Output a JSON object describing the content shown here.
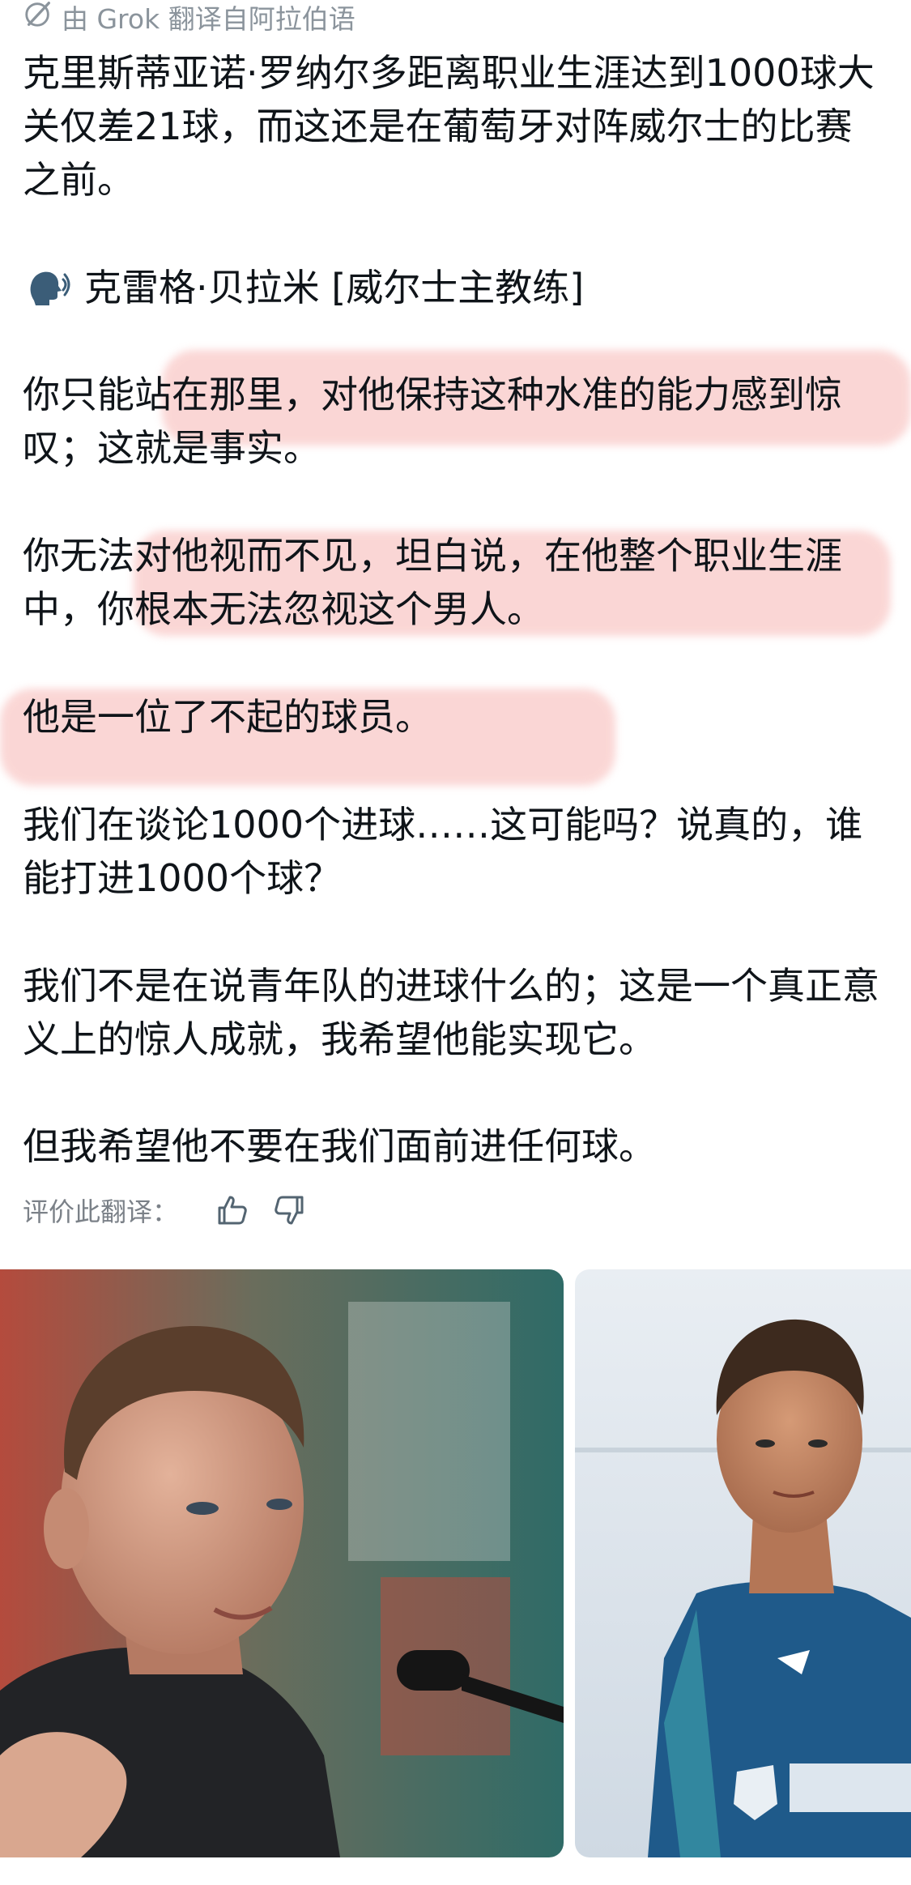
{
  "header": {
    "translated_by": "由 Grok 翻译自阿拉伯语",
    "icon": "translate-icon"
  },
  "post": {
    "intro": "克里斯蒂亚诺·罗纳尔多距离职业生涯达到1000球大关仅差21球，而这还是在葡萄牙对阵威尔士的比赛之前。",
    "speaker_emoji": "speaking-head-icon",
    "speaker": "克雷格·贝拉米 [威尔士主教练]",
    "quote_1": "你只能站在那里，对他保持这种水准的能力感到惊叹；这就是事实。",
    "quote_2": "你无法对他视而不见，坦白说，在他整个职业生涯中，你根本无法忽视这个男人。",
    "quote_3": "他是一位了不起的球员。",
    "quote_4": "我们在谈论1000个进球……这可能吗？说真的，谁能打进1000个球？",
    "quote_5": "我们不是在说青年队的进球什么的；这是一个真正意义上的惊人成就，我希望他能实现它。",
    "quote_6": "但我希望他不要在我们面前进任何球。"
  },
  "rating": {
    "label": "评价此翻译：",
    "thumbs_up_icon": "thumbs-up-icon",
    "thumbs_down_icon": "thumbs-down-icon"
  },
  "colors": {
    "text": "#0f1419",
    "muted": "#8b949c",
    "highlight": "#f9c6c4"
  }
}
